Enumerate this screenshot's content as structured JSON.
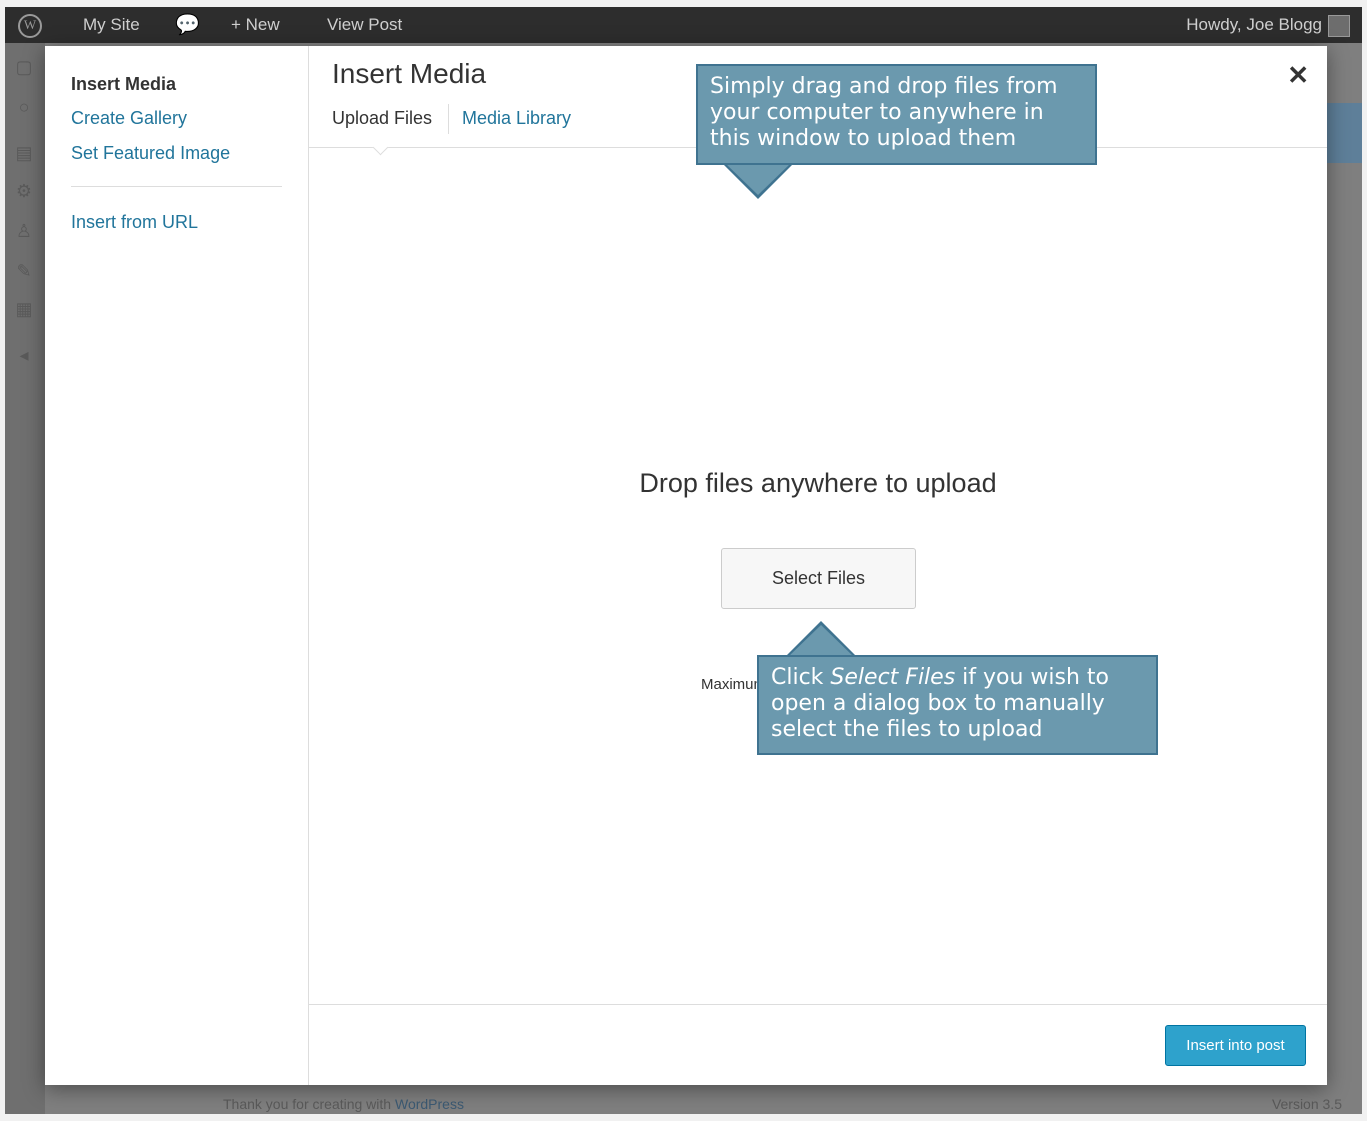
{
  "adminbar": {
    "wp_logo_glyph": "W",
    "site": "My Site",
    "comments_glyph": "💬",
    "new": "+ New",
    "view_post": "View Post",
    "howdy": "Howdy, Joe Blogg"
  },
  "backdrop": {
    "footer_text_prefix": "Thank you for creating with ",
    "footer_link": "WordPress",
    "version": "Version 3.5"
  },
  "menu": {
    "items": [
      {
        "label": "Insert Media",
        "active": true
      },
      {
        "label": "Create Gallery",
        "active": false
      },
      {
        "label": "Set Featured Image",
        "active": false
      },
      {
        "label": "Insert from URL",
        "active": false
      }
    ]
  },
  "frame": {
    "title": "Insert Media",
    "close_glyph": "✕",
    "tabs": [
      {
        "label": "Upload Files",
        "active": true
      },
      {
        "label": "Media Library",
        "active": false
      }
    ]
  },
  "upload": {
    "drop_text": "Drop files anywhere to upload",
    "select_button": "Select Files",
    "max_text": "Maximum upload file size: 32MB."
  },
  "toolbar": {
    "insert_button": "Insert into post"
  },
  "callouts": {
    "drag_drop": "Simply drag and drop files from your computer to anywhere in this window to upload them",
    "select_prefix": "Click ",
    "select_emphasis": "Select Files",
    "select_suffix": " if you wish to open a dialog box to manually select the files to upload"
  },
  "colors": {
    "accent": "#2ea2cc",
    "link": "#21759b",
    "callout_bg": "#6b99ae",
    "callout_border": "#3f7390",
    "adminbar_bg": "#2d2d2d"
  }
}
